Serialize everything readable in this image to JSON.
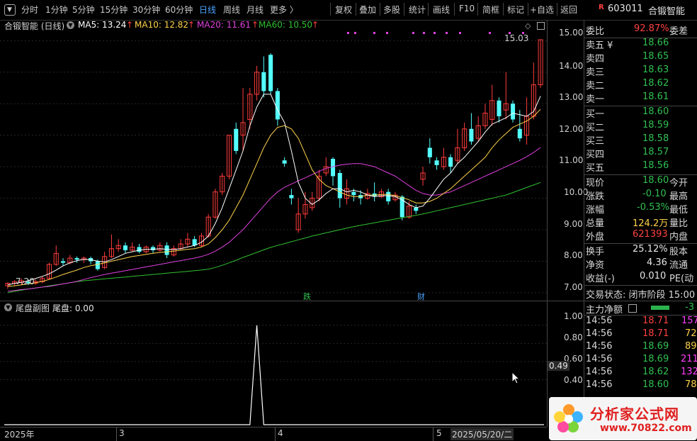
{
  "toolbar": {
    "periods": [
      "分时",
      "1分钟",
      "5分钟",
      "15分钟",
      "30分钟",
      "60分钟",
      "日线",
      "周线",
      "月线",
      "更多 〉"
    ],
    "active_period": "日线",
    "tools": [
      "复权",
      "叠加",
      "多股",
      "统计",
      "画线",
      "F10",
      "简框",
      "标记",
      "+自选",
      "返回"
    ]
  },
  "stock": {
    "badge": "R",
    "code": "603011",
    "name": "合锻智能"
  },
  "legend": {
    "title": "合锻智能 (日线)",
    "ma5": "MA5: 13.24",
    "ma10": "MA10: 12.82",
    "ma20": "MA20: 11.61",
    "ma60": "MA60: 10.50",
    "ma_colors": {
      "ma5": "#ffffff",
      "ma10": "#ffd24a",
      "ma20": "#e040e0",
      "ma60": "#30c030"
    }
  },
  "price_axis": {
    "ticks": [
      "15.00",
      "14.00",
      "13.00",
      "12.00",
      "11.00",
      "10.00",
      "9.00",
      "8.00",
      "7.00"
    ]
  },
  "chart_annotations": {
    "high_label": "15.03",
    "low_label": "7.20",
    "markers": [
      "跌",
      "财"
    ]
  },
  "chart_data": {
    "type": "candlestick",
    "ylim": [
      6.75,
      15.3
    ],
    "candles": [
      [
        7.22,
        7.3,
        7.12,
        7.33
      ],
      [
        7.3,
        7.35,
        7.22,
        7.4
      ],
      [
        7.33,
        7.38,
        7.25,
        7.45
      ],
      [
        7.35,
        7.3,
        7.25,
        7.42
      ],
      [
        7.3,
        7.36,
        7.25,
        7.42
      ],
      [
        7.35,
        7.45,
        7.3,
        7.52
      ],
      [
        7.45,
        7.9,
        7.42,
        7.95
      ],
      [
        7.9,
        8.25,
        7.85,
        8.5
      ],
      [
        8.0,
        7.95,
        7.85,
        8.1
      ],
      [
        7.95,
        8.1,
        7.9,
        8.2
      ],
      [
        8.1,
        8.05,
        7.95,
        8.15
      ],
      [
        8.05,
        8.1,
        7.95,
        8.15
      ],
      [
        8.1,
        8.0,
        7.9,
        8.15
      ],
      [
        8.0,
        7.75,
        7.7,
        8.05
      ],
      [
        7.8,
        8.15,
        7.75,
        8.3
      ],
      [
        8.15,
        8.4,
        8.1,
        8.85
      ],
      [
        8.4,
        8.5,
        8.3,
        8.7
      ],
      [
        8.5,
        8.35,
        8.25,
        8.6
      ],
      [
        8.35,
        8.45,
        8.3,
        8.6
      ],
      [
        8.45,
        8.3,
        8.25,
        8.55
      ],
      [
        8.3,
        8.45,
        8.25,
        8.5
      ],
      [
        8.45,
        8.35,
        8.25,
        8.5
      ],
      [
        8.35,
        8.5,
        8.3,
        8.6
      ],
      [
        8.5,
        8.2,
        8.1,
        8.6
      ],
      [
        8.2,
        8.4,
        8.15,
        8.5
      ],
      [
        8.4,
        8.55,
        8.35,
        8.7
      ],
      [
        8.55,
        8.7,
        8.45,
        8.9
      ],
      [
        8.7,
        8.5,
        8.45,
        8.8
      ],
      [
        8.5,
        8.8,
        8.45,
        8.9
      ],
      [
        8.8,
        9.4,
        8.75,
        9.5
      ],
      [
        9.4,
        10.2,
        9.35,
        10.3
      ],
      [
        10.2,
        10.7,
        10.1,
        10.8
      ],
      [
        10.7,
        12.0,
        10.6,
        12.0
      ],
      [
        12.2,
        11.5,
        11.4,
        12.4
      ],
      [
        12.0,
        12.4,
        11.5,
        13.5
      ],
      [
        12.5,
        13.3,
        12.2,
        13.5
      ],
      [
        13.3,
        14.0,
        13.1,
        14.2
      ],
      [
        14.0,
        13.4,
        13.2,
        14.5
      ],
      [
        14.55,
        13.4,
        13.3,
        14.6
      ],
      [
        13.4,
        12.5,
        12.3,
        13.5
      ],
      [
        11.2,
        11.1,
        11.0,
        11.3
      ],
      [
        10.1,
        10.0,
        9.8,
        10.3
      ],
      [
        9.0,
        9.5,
        8.9,
        10.0
      ],
      [
        9.5,
        9.8,
        9.35,
        10.2
      ],
      [
        9.7,
        10.0,
        9.6,
        10.2
      ],
      [
        10.0,
        10.7,
        9.9,
        10.9
      ],
      [
        10.8,
        11.0,
        10.7,
        11.3
      ],
      [
        11.25,
        10.7,
        10.4,
        11.3
      ],
      [
        10.8,
        10.0,
        9.7,
        10.9
      ],
      [
        10.0,
        10.3,
        9.8,
        10.6
      ],
      [
        10.2,
        10.1,
        9.9,
        10.3
      ],
      [
        10.1,
        10.0,
        9.8,
        10.25
      ],
      [
        10.0,
        10.15,
        9.95,
        10.3
      ],
      [
        10.15,
        10.05,
        9.9,
        10.5
      ],
      [
        10.05,
        10.2,
        10.0,
        10.3
      ],
      [
        10.2,
        9.9,
        9.8,
        10.3
      ],
      [
        9.95,
        10.1,
        9.9,
        10.2
      ],
      [
        10.05,
        9.4,
        9.3,
        10.1
      ],
      [
        9.4,
        9.75,
        9.35,
        9.9
      ],
      [
        9.7,
        9.6,
        9.5,
        9.8
      ],
      [
        10.6,
        10.8,
        10.4,
        11.0
      ],
      [
        11.6,
        11.3,
        11.1,
        11.9
      ],
      [
        11.2,
        11.05,
        10.9,
        11.3
      ],
      [
        11.0,
        11.3,
        10.9,
        11.6
      ],
      [
        11.3,
        11.0,
        10.8,
        11.4
      ],
      [
        11.2,
        11.6,
        11.1,
        12.2
      ],
      [
        11.6,
        12.2,
        11.5,
        12.4
      ],
      [
        12.2,
        11.8,
        11.7,
        12.7
      ],
      [
        11.9,
        12.3,
        11.8,
        12.6
      ],
      [
        12.3,
        12.7,
        12.2,
        13.0
      ],
      [
        12.5,
        13.1,
        12.3,
        13.6
      ],
      [
        13.1,
        12.6,
        12.4,
        13.2
      ],
      [
        12.8,
        13.0,
        12.5,
        14.0
      ],
      [
        13.0,
        12.5,
        12.4,
        13.1
      ],
      [
        12.2,
        11.9,
        11.8,
        12.8
      ],
      [
        12.0,
        12.6,
        11.7,
        13.2
      ],
      [
        12.6,
        13.6,
        12.5,
        14.3
      ],
      [
        13.6,
        15.03,
        13.5,
        15.03
      ]
    ],
    "ma5": [
      7.25,
      7.3,
      7.33,
      7.38,
      7.45,
      7.52,
      7.6,
      7.72,
      7.85,
      7.95,
      8.02,
      8.06,
      8.05,
      8.0,
      7.98,
      8.05,
      8.15,
      8.25,
      8.3,
      8.35,
      8.38,
      8.38,
      8.4,
      8.38,
      8.37,
      8.4,
      8.45,
      8.5,
      8.6,
      8.8,
      9.2,
      9.7,
      10.3,
      10.9,
      11.5,
      12.3,
      12.9,
      13.3,
      13.3,
      12.8,
      12.4,
      11.5,
      10.5,
      10.0,
      9.8,
      9.95,
      10.15,
      10.3,
      10.3,
      10.2,
      10.25,
      10.2,
      10.1,
      10.05,
      10.08,
      10.08,
      10.05,
      9.95,
      9.8,
      9.7,
      9.75,
      10.0,
      10.3,
      10.6,
      10.8,
      11.1,
      11.3,
      11.55,
      11.8,
      12.1,
      12.35,
      12.45,
      12.55,
      12.7,
      12.65,
      12.6,
      12.75,
      13.24
    ],
    "ma10": [
      7.2,
      7.22,
      7.25,
      7.28,
      7.32,
      7.36,
      7.42,
      7.5,
      7.58,
      7.65,
      7.72,
      7.8,
      7.86,
      7.9,
      7.95,
      8.0,
      8.05,
      8.1,
      8.15,
      8.18,
      8.22,
      8.25,
      8.28,
      8.3,
      8.32,
      8.35,
      8.38,
      8.4,
      8.45,
      8.55,
      8.75,
      9.0,
      9.3,
      9.7,
      10.1,
      10.6,
      11.1,
      11.6,
      12.0,
      12.25,
      12.3,
      12.2,
      11.9,
      11.4,
      10.9,
      10.6,
      10.4,
      10.3,
      10.2,
      10.1,
      10.05,
      10.05,
      10.1,
      10.1,
      10.12,
      10.12,
      10.08,
      10.02,
      9.95,
      9.85,
      9.85,
      9.9,
      10.0,
      10.15,
      10.3,
      10.5,
      10.7,
      10.9,
      11.1,
      11.3,
      11.6,
      11.85,
      12.05,
      12.25,
      12.35,
      12.45,
      12.6,
      12.82
    ],
    "ma20": [
      7.05,
      7.07,
      7.1,
      7.12,
      7.15,
      7.18,
      7.2,
      7.24,
      7.28,
      7.32,
      7.36,
      7.42,
      7.48,
      7.53,
      7.58,
      7.62,
      7.66,
      7.7,
      7.74,
      7.78,
      7.82,
      7.86,
      7.9,
      7.94,
      7.98,
      8.02,
      8.06,
      8.1,
      8.15,
      8.22,
      8.32,
      8.45,
      8.6,
      8.8,
      9.0,
      9.25,
      9.5,
      9.75,
      10.0,
      10.2,
      10.35,
      10.45,
      10.55,
      10.65,
      10.75,
      10.85,
      10.95,
      11.0,
      11.05,
      11.08,
      11.1,
      11.1,
      11.05,
      11.0,
      10.9,
      10.8,
      10.7,
      10.55,
      10.4,
      10.25,
      10.15,
      10.1,
      10.1,
      10.15,
      10.2,
      10.3,
      10.4,
      10.5,
      10.6,
      10.7,
      10.8,
      10.9,
      11.0,
      11.1,
      11.2,
      11.32,
      11.45,
      11.61
    ],
    "ma60": [
      7.0,
      7.05,
      7.08,
      7.12,
      7.15,
      7.18,
      7.22,
      7.25,
      7.28,
      7.32,
      7.35,
      7.38,
      7.4,
      7.42,
      7.44,
      7.46,
      7.48,
      7.5,
      7.52,
      7.54,
      7.56,
      7.58,
      7.6,
      7.62,
      7.64,
      7.66,
      7.68,
      7.7,
      7.72,
      7.75,
      7.8,
      7.87,
      7.95,
      8.03,
      8.12,
      8.2,
      8.28,
      8.36,
      8.44,
      8.5,
      8.56,
      8.62,
      8.68,
      8.74,
      8.8,
      8.85,
      8.9,
      8.95,
      9.0,
      9.05,
      9.1,
      9.14,
      9.18,
      9.22,
      9.26,
      9.3,
      9.34,
      9.38,
      9.42,
      9.46,
      9.5,
      9.55,
      9.6,
      9.65,
      9.7,
      9.75,
      9.8,
      9.85,
      9.9,
      9.95,
      10.0,
      10.05,
      10.1,
      10.18,
      10.26,
      10.34,
      10.42,
      10.5
    ],
    "sub_chart": {
      "type": "line",
      "title": "尾盘副图",
      "series": [
        {
          "name": "尾盘",
          "spike_index": 36,
          "value": 1.0
        }
      ],
      "ylim": [
        0.2,
        1.1
      ]
    }
  },
  "sub_panel": {
    "title": "尾盘副图",
    "legend": "尾盘: 0.00",
    "ticks": [
      "1.00",
      "0.80",
      "0.60",
      "0.40"
    ],
    "current": "0.49"
  },
  "time_axis": {
    "labels": [
      "2025年",
      "3",
      "4",
      "5",
      "2025/05/20/二"
    ]
  },
  "order_book": {
    "weibi_label": "委比",
    "weibi_value": "92.87%",
    "weicha_label": "委差",
    "asks": [
      {
        "label": "卖五 ¥",
        "price": "18.66"
      },
      {
        "label": "卖四",
        "price": "18.65"
      },
      {
        "label": "卖三",
        "price": "18.63"
      },
      {
        "label": "卖二",
        "price": "18.62"
      },
      {
        "label": "卖一",
        "price": "18.61"
      }
    ],
    "bids": [
      {
        "label": "买一",
        "price": "18.60"
      },
      {
        "label": "买二",
        "price": "18.59"
      },
      {
        "label": "买三",
        "price": "18.58"
      },
      {
        "label": "买四",
        "price": "18.57"
      },
      {
        "label": "买五",
        "price": "18.56"
      }
    ]
  },
  "quote": {
    "rows": [
      {
        "label": "现价",
        "value": "18.60",
        "color": "green",
        "extra": "今开"
      },
      {
        "label": "涨跌",
        "value": "-0.10",
        "color": "green",
        "extra": "最高"
      },
      {
        "label": "涨幅",
        "value": "-0.53%",
        "color": "green",
        "extra": "最低"
      },
      {
        "label": "总量",
        "value": "124.2万",
        "color": "yellow",
        "extra": "量比"
      },
      {
        "label": "外盘",
        "value": "621393",
        "color": "red",
        "extra": "内盘"
      },
      {
        "label": "换手",
        "value": "25.12%",
        "color": "white",
        "extra": "股本"
      },
      {
        "label": "净资",
        "value": "4.36",
        "color": "white",
        "extra": "流通"
      },
      {
        "label": "收益(-)",
        "value": "0.010",
        "color": "white",
        "extra": "PE(动"
      }
    ],
    "status": "交易状态: 闭市阶段 15:00"
  },
  "capital_flow": {
    "title": "主力净额",
    "value": "-3"
  },
  "ticks": [
    {
      "time": "14:56",
      "price": "18.71",
      "color": "red",
      "vol": "157",
      "vcolor": "magenta"
    },
    {
      "time": "14:56",
      "price": "18.71",
      "color": "red",
      "vol": "72",
      "vcolor": "yellow"
    },
    {
      "time": "14:56",
      "price": "18.69",
      "color": "green",
      "vol": "89",
      "vcolor": "yellow"
    },
    {
      "time": "14:56",
      "price": "18.69",
      "color": "green",
      "vol": "211",
      "vcolor": "magenta"
    },
    {
      "time": "14:56",
      "price": "18.62",
      "color": "green",
      "vol": "132",
      "vcolor": "magenta"
    },
    {
      "time": "14:56",
      "price": "18.60",
      "color": "green",
      "vol": "78",
      "vcolor": "yellow"
    }
  ],
  "watermark": {
    "text": "分析家公式网",
    "url": "www.70822.com"
  }
}
